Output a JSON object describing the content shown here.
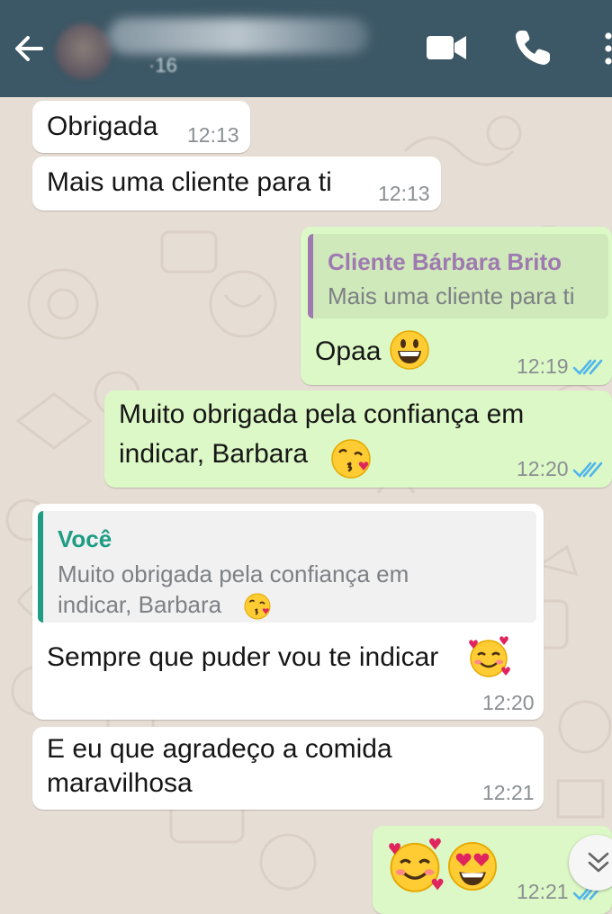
{
  "header": {
    "last_seen": "16",
    "icons": [
      "back-arrow-icon",
      "video-call-icon",
      "phone-call-icon",
      "more-options-icon"
    ],
    "colors": {
      "bar": "#3c5765",
      "icon": "#ffffff"
    }
  },
  "messages": [
    {
      "direction": "incoming",
      "text": "Obrigada",
      "time": "12:13"
    },
    {
      "direction": "incoming",
      "text": "Mais uma cliente para ti",
      "time": "12:13"
    },
    {
      "direction": "outgoing",
      "quote": {
        "author": "Cliente Bárbara Brito",
        "text": "Mais uma cliente para ti"
      },
      "text": "Opaa",
      "emoji": "grinning-face",
      "time": "12:19",
      "status": "read"
    },
    {
      "direction": "outgoing",
      "lines": [
        "Muito obrigada pela confiança em",
        "indicar, Barbara"
      ],
      "emoji": "face-blowing-kiss",
      "time": "12:20",
      "status": "read"
    },
    {
      "direction": "incoming",
      "quote": {
        "author": "Você",
        "lines": [
          "Muito obrigada pela confiança em",
          "indicar, Barbara"
        ],
        "emoji": "face-blowing-kiss"
      },
      "text": "Sempre que puder vou te indicar",
      "emoji": "smiling-face-with-hearts",
      "time": "12:20"
    },
    {
      "direction": "incoming",
      "lines": [
        "E eu que agradeço a comida",
        "maravilhosa"
      ],
      "time": "12:21"
    },
    {
      "direction": "outgoing",
      "emojis": [
        "smiling-face-with-hearts",
        "heart-eyes-face"
      ],
      "time": "12:21",
      "status": "read"
    }
  ],
  "scroll_button": {
    "icon": "double-chevron-down-icon"
  },
  "colors": {
    "incoming_bubble": "#ffffff",
    "outgoing_bubble": "#dcf8c6",
    "read_ticks": "#4fb6ec",
    "quote_author_out": "#9f7ab0",
    "quote_author_in": "#1f9d84",
    "wallpaper": "#e6ddd4"
  }
}
